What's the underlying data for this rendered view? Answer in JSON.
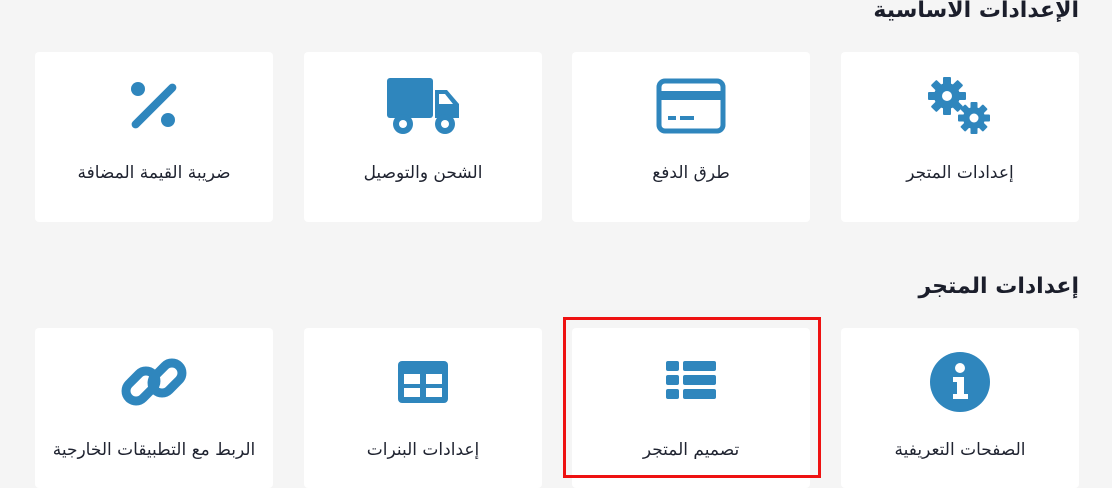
{
  "colors": {
    "icon": "#2f86bd",
    "highlight": "#ee1111",
    "background": "#f5f5f5",
    "card": "#ffffff"
  },
  "sections": {
    "basic": {
      "title": "الإعدادات الاساسية",
      "cards": [
        {
          "label": "إعدادات المتجر",
          "icon": "gears-icon"
        },
        {
          "label": "طرق الدفع",
          "icon": "credit-card-icon"
        },
        {
          "label": "الشحن والتوصيل",
          "icon": "truck-icon"
        },
        {
          "label": "ضريبة القيمة المضافة",
          "icon": "percent-icon"
        }
      ]
    },
    "store": {
      "title": "إعدادات المتجر",
      "cards": [
        {
          "label": "الصفحات التعريفية",
          "icon": "info-circle-icon"
        },
        {
          "label": "تصميم المتجر",
          "icon": "list-icon"
        },
        {
          "label": "إعدادات البنرات",
          "icon": "table-icon"
        },
        {
          "label": "الربط مع التطبيقات الخارجية",
          "icon": "link-icon"
        }
      ]
    }
  }
}
